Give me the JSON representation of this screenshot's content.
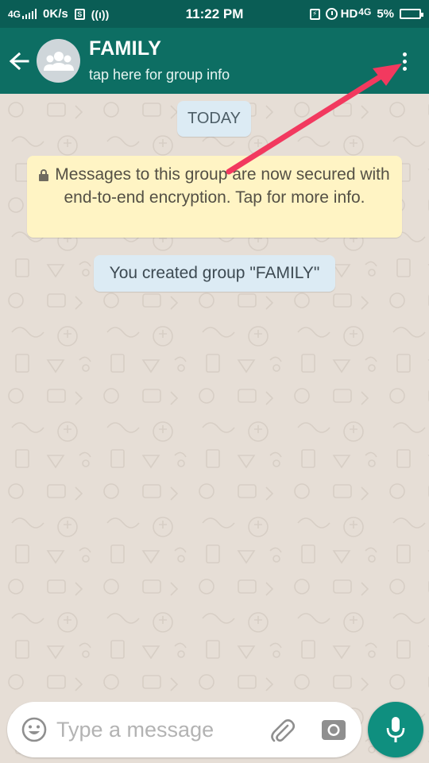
{
  "status_bar": {
    "network": "4G",
    "speed": "0K/s",
    "sim_label": "S",
    "time": "11:22 PM",
    "hd_label": "HD",
    "network_right": "4G",
    "battery": "5%"
  },
  "header": {
    "back_icon": "arrow-left-icon",
    "avatar_icon": "group-icon",
    "title": "FAMILY",
    "subtitle": "tap here for group info",
    "menu_icon": "more-vertical-icon"
  },
  "chat": {
    "date_label": "TODAY",
    "encryption_notice": "Messages to this group are now secured with end-to-end encryption. Tap for more info.",
    "system_message": "You created group \"FAMILY\""
  },
  "input": {
    "placeholder": "Type a message",
    "emoji_icon": "emoji-icon",
    "attach_icon": "paperclip-icon",
    "camera_icon": "camera-icon",
    "mic_icon": "microphone-icon"
  },
  "colors": {
    "header": "#0d6e63",
    "status_bar": "#0a5d55",
    "chat_background": "#e6ded6",
    "accent": "#0f8f7f",
    "annotation_arrow": "#f2395f"
  }
}
